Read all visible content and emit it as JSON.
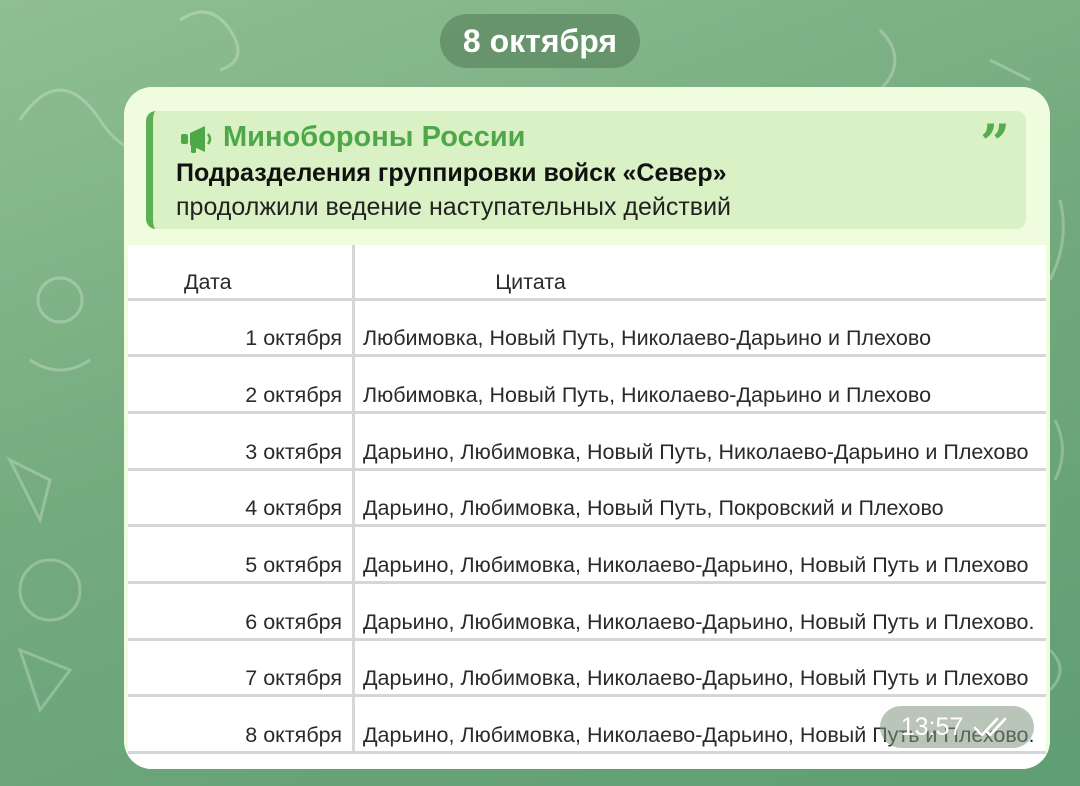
{
  "chat": {
    "date_separator": "8 октября",
    "message": {
      "reply": {
        "channel": "Минобороны России",
        "title": "Подразделения группировки войск «Север»",
        "subtitle": "продолжили ведение наступательных действий",
        "icon": "megaphone-icon"
      },
      "table": {
        "headers": [
          "Дата",
          "Цитата"
        ],
        "rows": [
          [
            "1 октября",
            "Любимовка, Новый Путь, Николаево-Дарьино и Плехово"
          ],
          [
            "2 октября",
            "Любимовка, Новый Путь, Николаево-Дарьино и Плехово"
          ],
          [
            "3 октября",
            "Дарьино, Любимовка, Новый Путь, Николаево-Дарьино и Плехово"
          ],
          [
            "4 октября",
            "Дарьино, Любимовка, Новый Путь, Покровский и Плехово"
          ],
          [
            "5 октября",
            "Дарьино, Любимовка, Николаево-Дарьино, Новый Путь и Плехово"
          ],
          [
            "6 октября",
            "Дарьино, Любимовка, Николаево-Дарьино, Новый Путь и Плехово."
          ],
          [
            "7 октября",
            "Дарьино, Любимовка, Николаево-Дарьино, Новый Путь и Плехово"
          ],
          [
            "8 октября",
            "Дарьино, Любимовка, Николаево-Дарьино, Новый Путь и Плехово."
          ]
        ]
      },
      "time": "13:57",
      "status_icon": "double-check-icon"
    }
  },
  "colors": {
    "accent": "#5caf54",
    "bubble": "#effdde",
    "reply_bg": "#d9f1c5"
  }
}
